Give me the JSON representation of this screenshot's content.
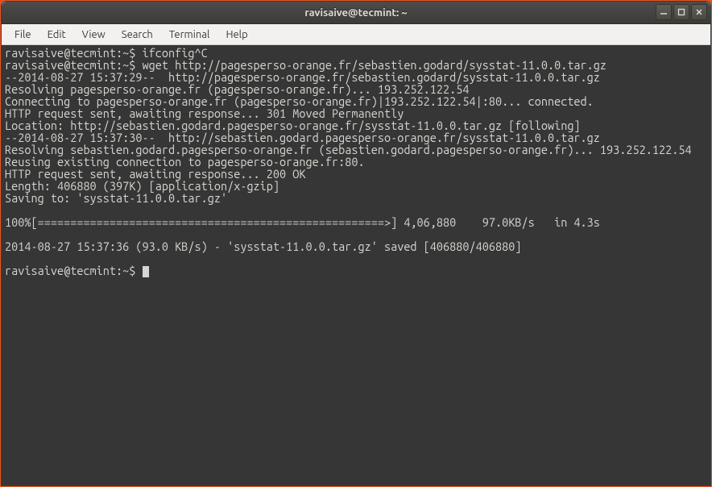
{
  "window": {
    "title": "ravisaive@tecmint: ~"
  },
  "menu": {
    "file": "File",
    "edit": "Edit",
    "view": "View",
    "search": "Search",
    "terminal": "Terminal",
    "help": "Help"
  },
  "terminal": {
    "line1": "ravisaive@tecmint:~$ ifconfig^C",
    "line2": "ravisaive@tecmint:~$ wget http://pagesperso-orange.fr/sebastien.godard/sysstat-11.0.0.tar.gz",
    "line3": "--2014-08-27 15:37:29--  http://pagesperso-orange.fr/sebastien.godard/sysstat-11.0.0.tar.gz",
    "line4": "Resolving pagesperso-orange.fr (pagesperso-orange.fr)... 193.252.122.54",
    "line5": "Connecting to pagesperso-orange.fr (pagesperso-orange.fr)|193.252.122.54|:80... connected.",
    "line6": "HTTP request sent, awaiting response... 301 Moved Permanently",
    "line7": "Location: http://sebastien.godard.pagesperso-orange.fr/sysstat-11.0.0.tar.gz [following]",
    "line8": "--2014-08-27 15:37:30--  http://sebastien.godard.pagesperso-orange.fr/sysstat-11.0.0.tar.gz",
    "line9": "Resolving sebastien.godard.pagesperso-orange.fr (sebastien.godard.pagesperso-orange.fr)... 193.252.122.54",
    "line10": "Reusing existing connection to pagesperso-orange.fr:80.",
    "line11": "HTTP request sent, awaiting response... 200 OK",
    "line12": "Length: 406880 (397K) [application/x-gzip]",
    "line13": "Saving to: 'sysstat-11.0.0.tar.gz'",
    "line14": "",
    "line15": "100%[=====================================================>] 4,06,880    97.0KB/s   in 4.3s",
    "line16": "",
    "line17": "2014-08-27 15:37:36 (93.0 KB/s) - 'sysstat-11.0.0.tar.gz' saved [406880/406880]",
    "line18": "",
    "line19": "ravisaive@tecmint:~$ "
  }
}
